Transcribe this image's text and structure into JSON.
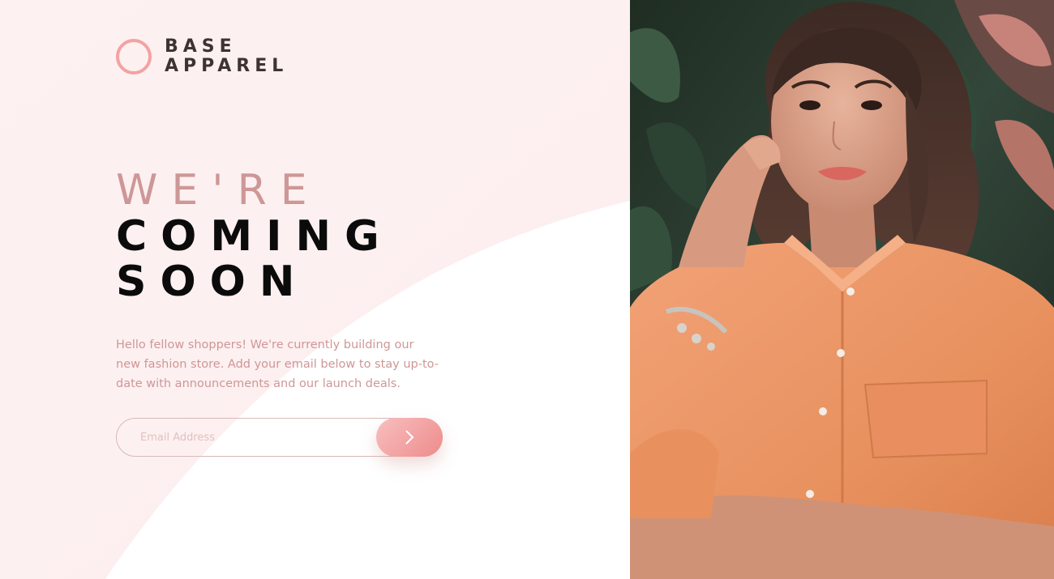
{
  "brand": {
    "line1": "BASE",
    "line2": "APPAREL",
    "accent_color": "#f4a2a2",
    "text_color": "#3d3333"
  },
  "headline": {
    "light": "WE'RE",
    "bold_line1": "COMING",
    "bold_line2": "SOON",
    "light_color": "#ce9797",
    "bold_color": "#0b0b0b"
  },
  "description": "Hello fellow shoppers! We're currently building our new fashion store. Add your email below to stay up-to-date with announcements and our launch deals.",
  "form": {
    "email_placeholder": "Email Address",
    "email_value": "",
    "submit_icon": "arrow-right-icon",
    "button_gradient": [
      "#f8bfbf",
      "#ee8b8b"
    ]
  },
  "hero_image": {
    "icon": "hero-photo",
    "subject": "woman-in-orange-shirt"
  }
}
